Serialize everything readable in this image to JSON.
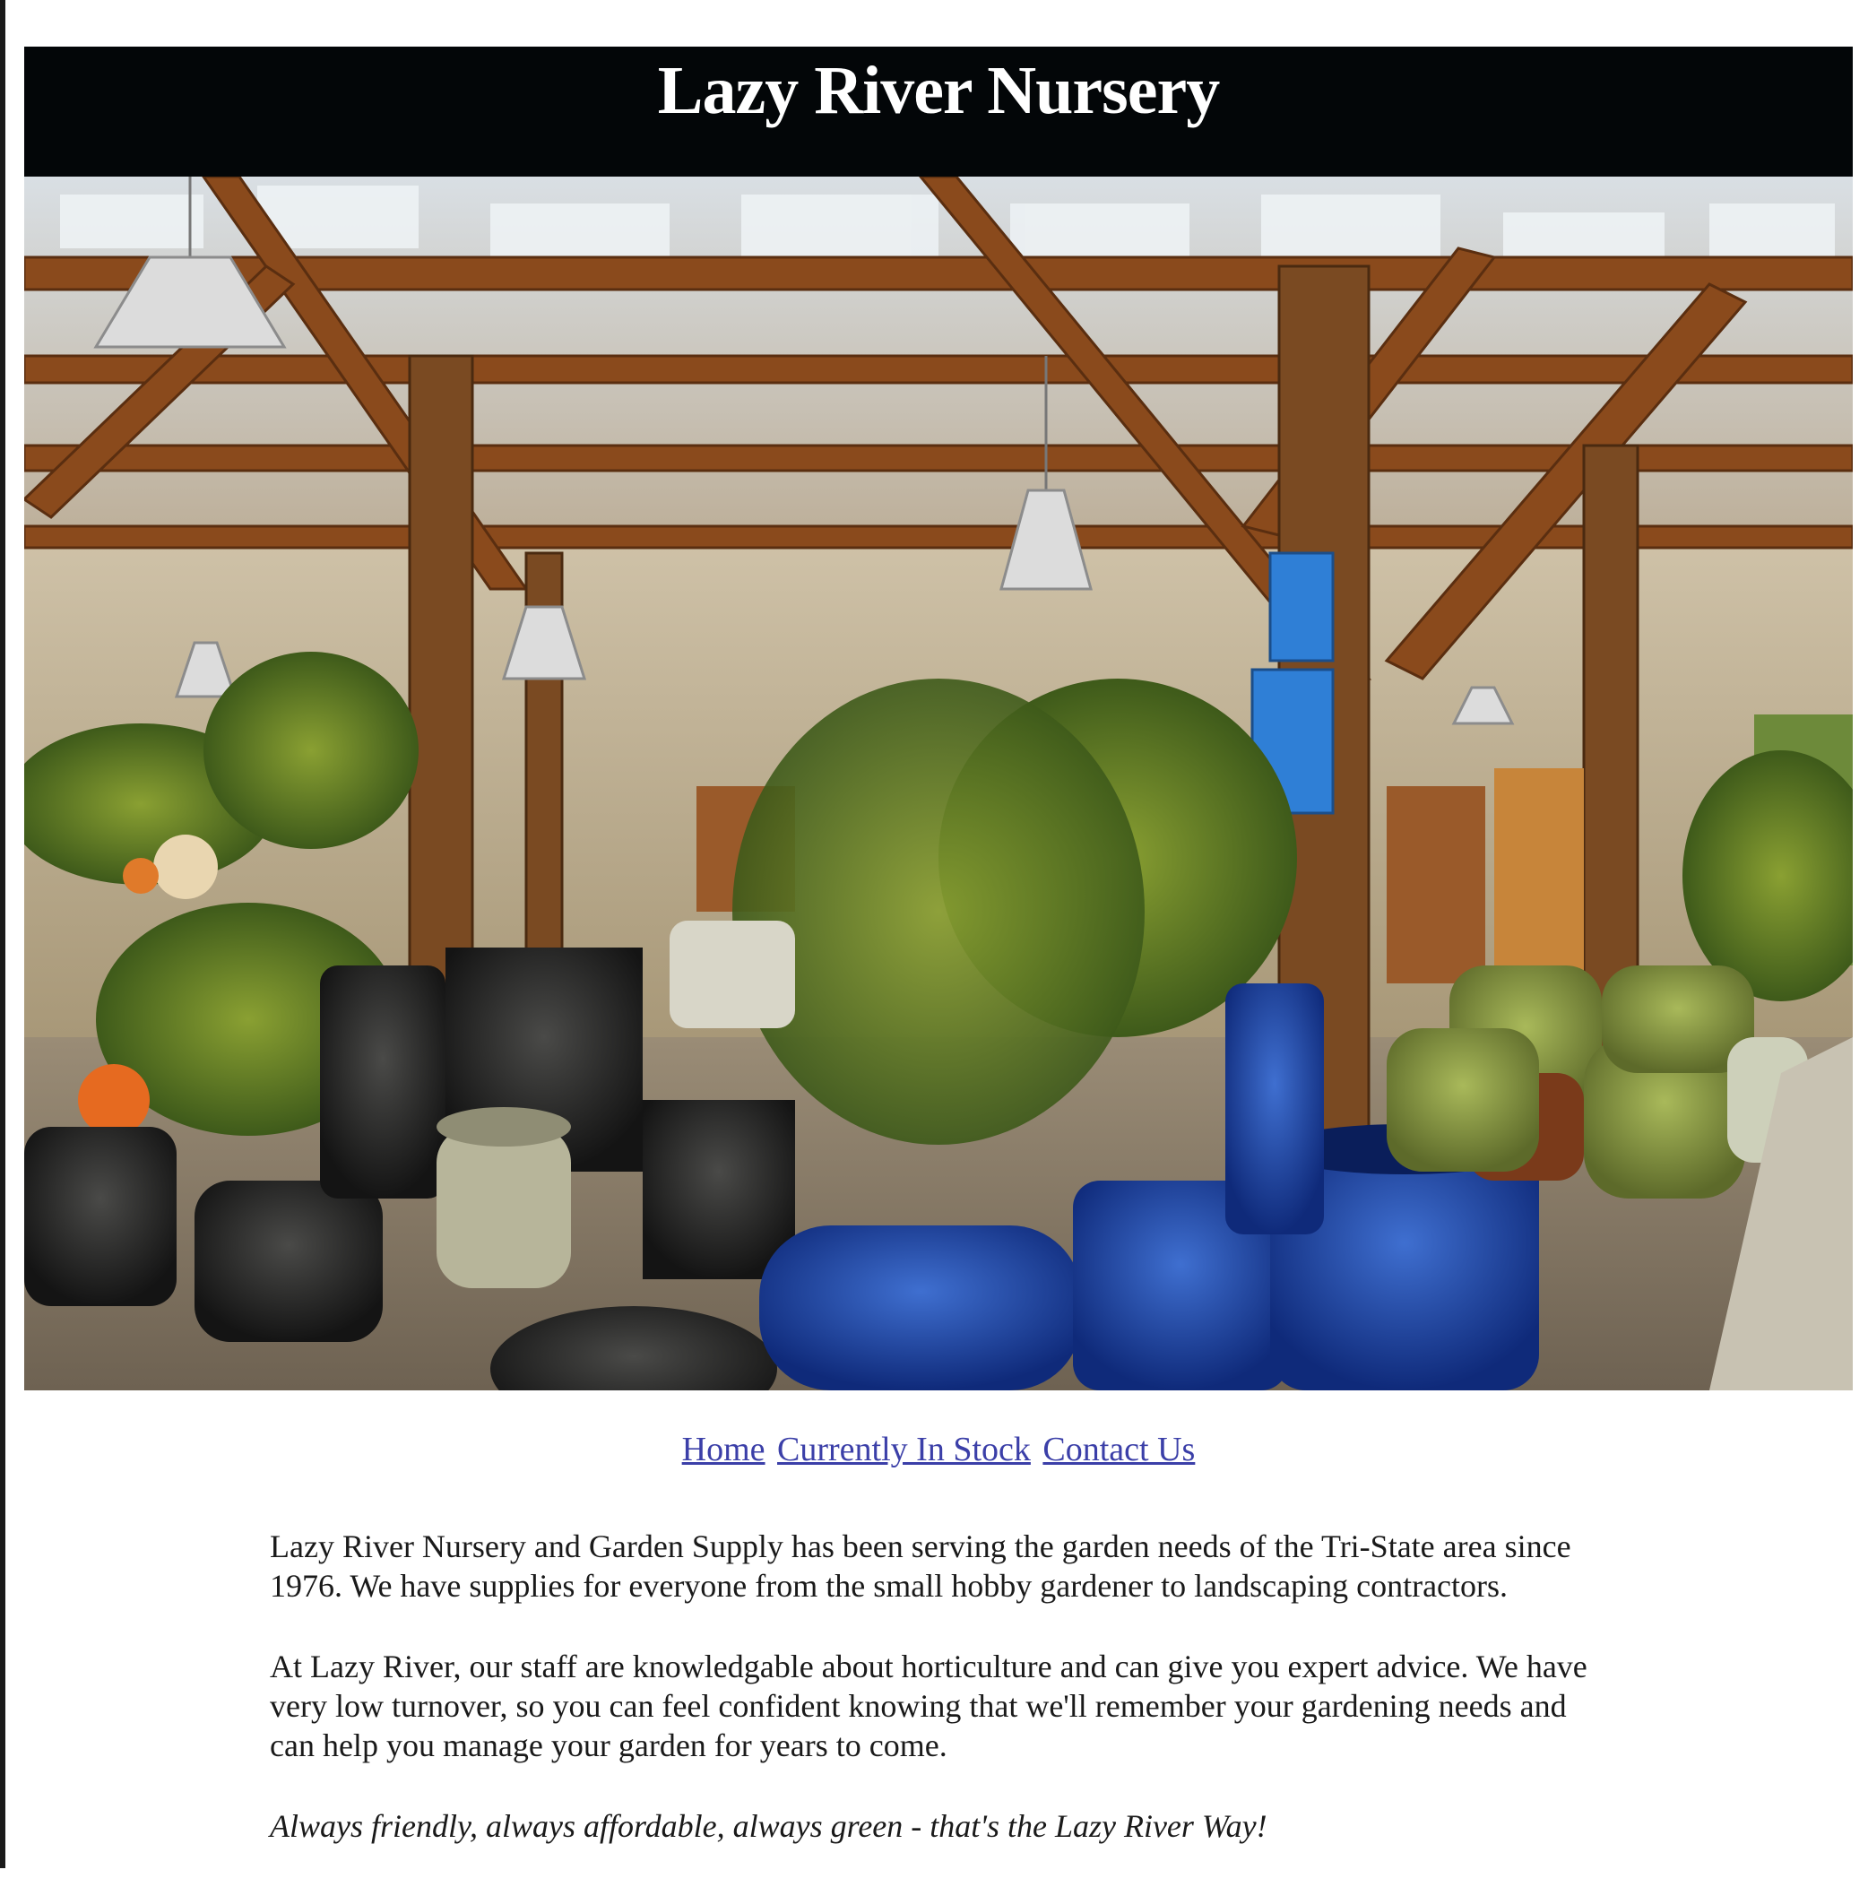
{
  "header": {
    "title": "Lazy River Nursery"
  },
  "hero": {
    "alt": "Interior of the nursery with wooden beams, hanging lamps and glazed pots"
  },
  "nav": {
    "links": [
      {
        "label": "Home"
      },
      {
        "label": "Currently In Stock"
      },
      {
        "label": "Contact Us"
      }
    ]
  },
  "content": {
    "paragraph1": "Lazy River Nursery and Garden Supply has been serving the garden needs of the Tri-State area since 1976. We have supplies for everyone from the small hobby gardener to landscaping contractors.",
    "paragraph2": "At Lazy River, our staff are knowledgable about horticulture and can give you expert advice. We have very low turnover, so you can feel confident knowing that we'll remember your gardening needs and can help you manage your garden for years to come.",
    "tagline": "Always friendly, always affordable, always green - that's the Lazy River Way!"
  },
  "colors": {
    "header_bg": "#030608",
    "link": "#3b3fa8",
    "text": "#1a1a1a"
  }
}
